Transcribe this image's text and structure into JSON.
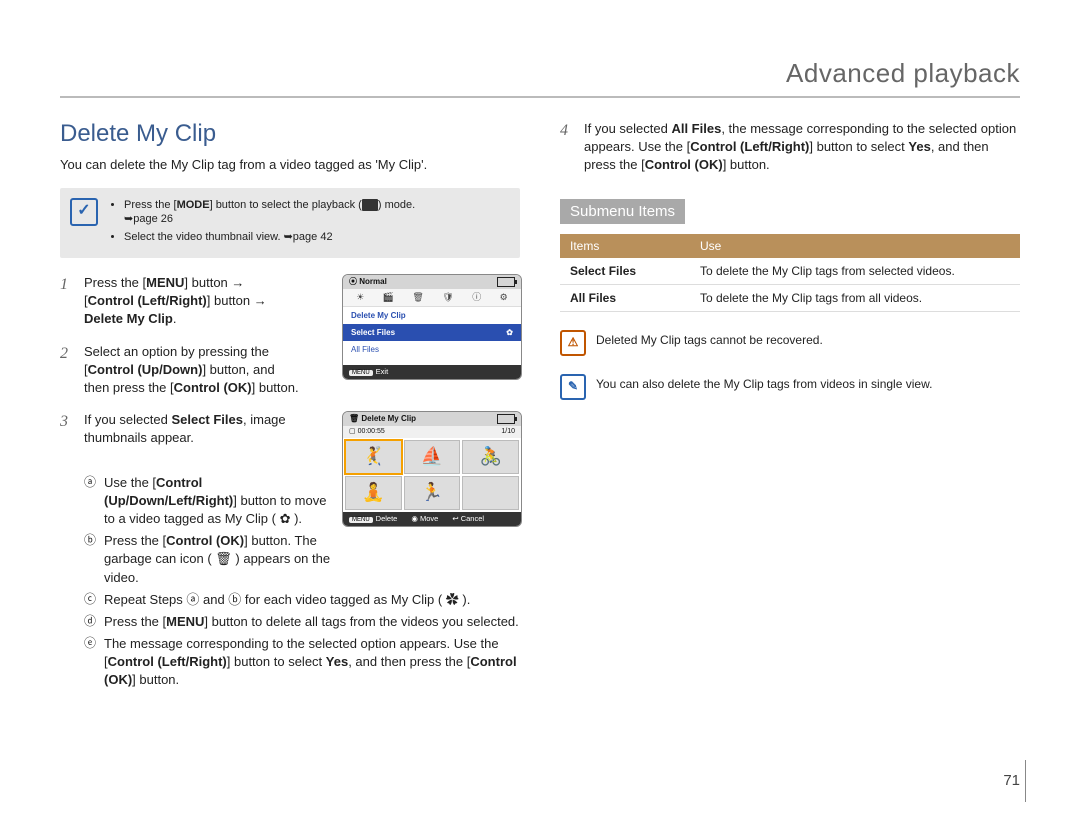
{
  "chapter": "Advanced playback",
  "page_number": "71",
  "left": {
    "heading": "Delete My Clip",
    "intro": "You can delete the My Clip tag from a video tagged as 'My Clip'.",
    "note": {
      "icon": "✓",
      "bullet1_a": "Press the [",
      "bullet1_b": "MODE",
      "bullet1_c": "] button to select the playback (",
      "bullet1_d": ") mode.",
      "bullet1_e": "➥page 26",
      "bullet2": "Select the video thumbnail view. ➥page 42"
    },
    "steps": {
      "s1": {
        "a": "Press the [",
        "b": "MENU",
        "c": "] button →",
        "d": "[",
        "e": "Control (Left/Right)",
        "f": "] button →",
        "g": "Delete My Clip",
        "h": "."
      },
      "s2": {
        "a": "Select an option by pressing the",
        "b": "[",
        "c": "Control (Up/Down)",
        "d": "] button, and",
        "e": "then press the [",
        "f": "Control (OK)",
        "g": "] button."
      },
      "s3": {
        "a": "If you selected ",
        "b": "Select Files",
        "c": ", image thumbnails appear.",
        "sub_a1": "Use the [",
        "sub_a2": "Control (Up/Down/Left/Right)",
        "sub_a3": "] button to move to a video tagged as My Clip ( ✿ ).",
        "sub_b1": "Press the [",
        "sub_b2": "Control (OK)",
        "sub_b3": "] button. The garbage can icon ( 🗑 ) appears on the video.",
        "sub_c": "Repeat Steps ⓐ and ⓑ for each video tagged as My Clip ( ✿ ).",
        "sub_d1": "Press the [",
        "sub_d2": "MENU",
        "sub_d3": "] button to delete all tags from the videos you selected.",
        "sub_e1": "The message corresponding to the selected option appears. Use the [",
        "sub_e2": "Control (Left/Right)",
        "sub_e3": "] button to select ",
        "sub_e4": "Yes",
        "sub_e5": ", and then press the [",
        "sub_e6": "Control (OK)",
        "sub_e7": "] button."
      }
    },
    "device1": {
      "title": "Normal",
      "menu_title": "Delete My Clip",
      "opt_selected": "Select Files",
      "opt2": "All Files",
      "footer_key": "MENU",
      "footer_label": "Exit"
    },
    "device2": {
      "title": "Delete My Clip",
      "time": "00:00:55",
      "count": "1/10",
      "f1k": "MENU",
      "f1l": "Delete",
      "f2l": "Move",
      "f3l": "Cancel"
    }
  },
  "right": {
    "step4": {
      "a": "If you selected ",
      "b": "All Files",
      "c": ", the message corresponding to the selected option appears. Use the [",
      "d": "Control (Left/Right)",
      "e": "] button to select ",
      "f": "Yes",
      "g": ", and then press the [",
      "h": "Control (OK)",
      "i": "] button."
    },
    "submenu_heading": "Submenu Items",
    "table": {
      "h1": "Items",
      "h2": "Use",
      "r1c1": "Select Files",
      "r1c2": "To delete the My Clip tags from selected videos.",
      "r2c1": "All Files",
      "r2c2": "To delete the My Clip tags from all videos."
    },
    "warn_icon": "⚠",
    "warn_text": "Deleted My Clip tags cannot be recovered.",
    "info_icon": "✎",
    "info_text": "You can also delete the My Clip tags from videos in single view."
  }
}
